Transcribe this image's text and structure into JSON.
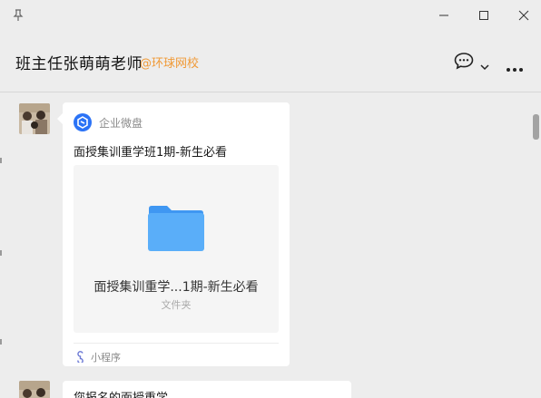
{
  "window": {
    "pin_icon": "pin-icon",
    "minimize_icon": "minimize-icon",
    "maximize_icon": "maximize-icon",
    "close_icon": "close-icon"
  },
  "header": {
    "title": "班主任张萌萌老师",
    "org": "@环球网校",
    "chat_icon": "chat-bubble-icon",
    "dropdown_icon": "chevron-down-icon",
    "more_icon": "more-icon"
  },
  "messages": [
    {
      "type": "mini-program-card",
      "app_name": "企业微盘",
      "card_title": "面授集训重学班1期-新生必看",
      "folder_name": "面授集训重学...1期-新生必看",
      "folder_type": "文件夹",
      "footer_label": "小程序"
    },
    {
      "type": "text",
      "text": "您报名的面授重学..."
    }
  ],
  "colors": {
    "background": "#ededed",
    "bubble": "#ffffff",
    "org_accent": "#f09a37",
    "folder": "#4fa3f7",
    "logo": "#2b73f6"
  }
}
